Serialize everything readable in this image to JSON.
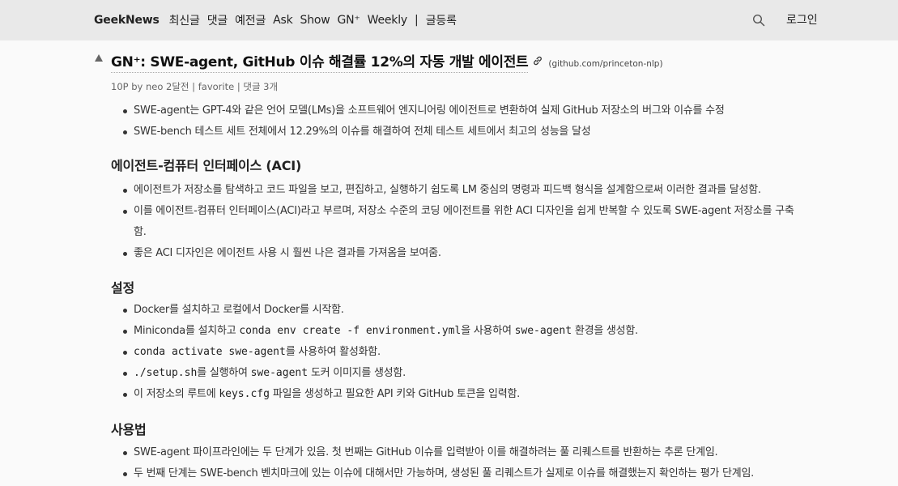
{
  "header": {
    "brand": "GeekNews",
    "nav": [
      "최신글",
      "댓글",
      "예전글",
      "Ask",
      "Show",
      "GN⁺",
      "Weekly"
    ],
    "separator": "|",
    "submit": "글등록",
    "login": "로그인"
  },
  "post": {
    "title": "GN⁺: SWE-agent, GitHub 이슈 해결률 12%의 자동 개발 에이전트",
    "domain": "(github.com/princeton-nlp)",
    "meta": {
      "points_by": "10P by neo 2달전",
      "sep": " | ",
      "favorite": "favorite",
      "comments": "댓글 3개"
    }
  },
  "content": {
    "intro": [
      "SWE-agent는 GPT-4와 같은 언어 모델(LMs)을 소프트웨어 엔지니어링 에이전트로 변환하여 실제 GitHub 저장소의 버그와 이슈를 수정",
      "SWE-bench 테스트 세트 전체에서 12.29%의 이슈를 해결하여 전체 테스트 세트에서 최고의 성능을 달성"
    ],
    "aci": {
      "heading": "에이전트-컴퓨터 인터페이스 (ACI)",
      "items": [
        "에이전트가 저장소를 탐색하고 코드 파일을 보고, 편집하고, 실행하기 쉽도록 LM 중심의 명령과 피드백 형식을 설계함으로써 이러한 결과를 달성함.",
        "이를 에이전트-컴퓨터 인터페이스(ACI)라고 부르며, 저장소 수준의 코딩 에이전트를 위한 ACI 디자인을 쉽게 반복할 수 있도록 SWE-agent 저장소를 구축함.",
        "좋은 ACI 디자인은 에이전트 사용 시 훨씬 나은 결과를 가져옴을 보여줌."
      ]
    },
    "setup": {
      "heading": "설정",
      "item1": "Docker를 설치하고 로컬에서 Docker를 시작함.",
      "item2": {
        "a": "Miniconda를 설치하고 ",
        "code1": "conda env create -f environment.yml",
        "b": "을 사용하여 ",
        "code2": "swe-agent",
        "c": " 환경을 생성함."
      },
      "item3": {
        "code1": "conda activate swe-agent",
        "a": "를 사용하여 활성화함."
      },
      "item4": {
        "code1": "./setup.sh",
        "a": "를 실행하여 ",
        "code2": "swe-agent",
        "b": " 도커 이미지를 생성함."
      },
      "item5": {
        "a": "이 저장소의 루트에 ",
        "code1": "keys.cfg",
        "b": " 파일을 생성하고 필요한 API 키와 GitHub 토큰을 입력함."
      }
    },
    "usage": {
      "heading": "사용법",
      "items": [
        "SWE-agent 파이프라인에는 두 단계가 있음. 첫 번째는 GitHub 이슈를 입력받아 이를 해결하려는 풀 리퀘스트를 반환하는 추론 단계임.",
        "두 번째 단계는 SWE-bench 벤치마크에 있는 이슈에 대해서만 가능하며, 생성된 풀 리퀘스트가 실제로 이슈를 해결했는지 확인하는 평가 단계임."
      ]
    }
  },
  "icons": {
    "search": "search-icon",
    "upvote": "upvote-arrow-icon",
    "link": "link-icon"
  }
}
